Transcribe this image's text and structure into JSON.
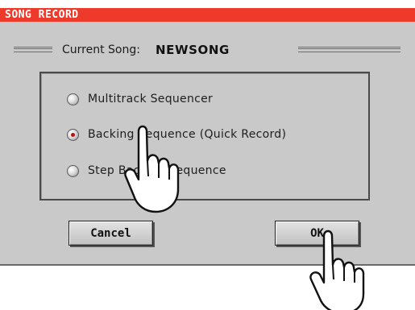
{
  "dialog": {
    "title": "SONG RECORD",
    "current_song_label": "Current Song:",
    "current_song_value": "NEWSONG",
    "options": [
      {
        "label": "Multitrack Sequencer",
        "selected": false
      },
      {
        "label": "Backing Sequence (Quick Record)",
        "selected": true
      },
      {
        "label": "Step Backing Sequence",
        "selected": false
      }
    ],
    "buttons": {
      "cancel": "Cancel",
      "ok": "OK"
    }
  },
  "colors": {
    "title_bar": "#ee3a2b",
    "panel": "#c9c9c9",
    "radio_selected": "#b0141a"
  },
  "icons": {
    "hand_pointer": "hand-pointer-icon"
  }
}
